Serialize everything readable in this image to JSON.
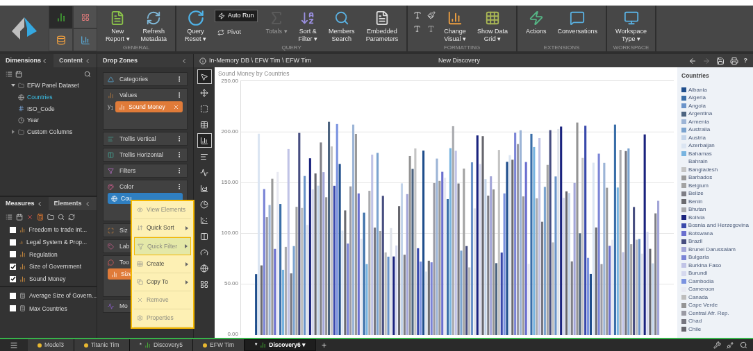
{
  "view_switcher": [
    {
      "selected": true
    },
    {
      "selected": false
    },
    {
      "selected": false
    },
    {
      "selected": false
    }
  ],
  "ribbon": [
    {
      "title": "GENERAL",
      "items": [
        {
          "kind": "large",
          "lines": [
            "New",
            "Report ▾"
          ],
          "disabled": false
        },
        {
          "kind": "large",
          "lines": [
            "Refresh",
            "Metadata"
          ],
          "disabled": false
        }
      ]
    },
    {
      "title": "QUERY",
      "items": [
        {
          "kind": "large",
          "lines": [
            "Query",
            "Reset ▾"
          ],
          "disabled": false
        },
        {
          "kind": "stack",
          "buttons": [
            {
              "label": "Auto Run",
              "on": true
            },
            {
              "label": "Pivot",
              "on": false
            }
          ]
        },
        {
          "kind": "large",
          "lines": [
            "Totals ▾"
          ],
          "disabled": true
        },
        {
          "kind": "large",
          "lines": [
            "Sort &",
            "Filter ▾"
          ],
          "disabled": false
        },
        {
          "kind": "large",
          "lines": [
            "Members",
            "Search"
          ],
          "disabled": false
        },
        {
          "kind": "large",
          "lines": [
            "Embedded",
            "Parameters"
          ],
          "disabled": false
        }
      ]
    },
    {
      "title": "FORMATTING",
      "items": [
        {
          "kind": "format"
        },
        {
          "kind": "large",
          "lines": [
            "Change",
            "Visual ▾"
          ],
          "disabled": false
        },
        {
          "kind": "large",
          "lines": [
            "Show Data",
            "Grid ▾"
          ],
          "disabled": false
        }
      ]
    },
    {
      "title": "EXTENSIONS",
      "items": [
        {
          "kind": "large",
          "lines": [
            "Actions"
          ],
          "disabled": false
        },
        {
          "kind": "large",
          "lines": [
            "Conversations"
          ],
          "disabled": false
        }
      ]
    },
    {
      "title": "WORKSPACE",
      "items": [
        {
          "kind": "large",
          "lines": [
            "Workspace",
            "Type ▾"
          ],
          "disabled": false
        }
      ]
    }
  ],
  "dimensions_panel": {
    "tabs": [
      {
        "label": "Dimensions",
        "selected": true
      },
      {
        "label": "Content",
        "selected": false
      }
    ],
    "tree": [
      {
        "label": "EFW Panel Dataset",
        "expanded": true,
        "children": [
          {
            "label": "Countries",
            "selected": true
          },
          {
            "label": "ISO_Code",
            "selected": false
          },
          {
            "label": "Year",
            "selected": false
          }
        ]
      },
      {
        "label": "Custom Columns",
        "expanded": false
      }
    ]
  },
  "measures_panel": {
    "tabs": [
      {
        "label": "Measures",
        "selected": true
      },
      {
        "label": "Elements",
        "selected": false
      }
    ],
    "measures": [
      {
        "label": "Freedom to trade int...",
        "checked": false
      },
      {
        "label": "Legal System & Prop...",
        "checked": false
      },
      {
        "label": "Regulation",
        "checked": false
      },
      {
        "label": "Size of Government",
        "checked": true
      },
      {
        "label": "Sound Money",
        "checked": true
      }
    ],
    "calculated": [
      {
        "label": "Average Size of Govern...",
        "checked": false
      },
      {
        "label": "Max Countries",
        "checked": false
      }
    ]
  },
  "drop_zones": {
    "title": "Drop Zones",
    "zones": [
      {
        "label": "Categories",
        "menu": true
      },
      {
        "label": "Values",
        "menu": true,
        "axis": "y$_{1}$",
        "chips": [
          {
            "label": "Sound Money",
            "kind": "measure",
            "removable": true
          }
        ]
      },
      {
        "label": "Trellis Vertical",
        "menu": true
      },
      {
        "label": "Trellis Horizontal",
        "menu": true
      },
      {
        "label": "Filters",
        "menu": true
      },
      {
        "label": "Color",
        "menu": true,
        "chips": [
          {
            "label": "Cou",
            "kind": "dimension"
          }
        ]
      },
      {
        "label": "Siz"
      },
      {
        "label": "Lab"
      },
      {
        "label": "Too",
        "chips": [
          {
            "label": "Size",
            "kind": "measure"
          }
        ]
      },
      {
        "label": "Mo"
      }
    ]
  },
  "context_menu": [
    {
      "label": "View Elements",
      "disabled": true,
      "submenu": false,
      "selected": false
    },
    {
      "label": "Quick Sort",
      "disabled": false,
      "submenu": true,
      "selected": false
    },
    {
      "label": "Quick Filter",
      "disabled": true,
      "submenu": true,
      "selected": true
    },
    {
      "label": "Create",
      "disabled": false,
      "submenu": true,
      "selected": false
    },
    {
      "label": "Copy To",
      "disabled": false,
      "submenu": true,
      "selected": false
    },
    {
      "label": "Remove",
      "disabled": true,
      "submenu": false,
      "selected": false
    },
    {
      "label": "Properties",
      "disabled": true,
      "submenu": false,
      "selected": false
    }
  ],
  "header": {
    "breadcrumb": "In-Memory DB \\ EFW Tim \\ EFW Tim",
    "title": "New Discovery",
    "help": "?"
  },
  "tools": [
    {
      "selected": true
    },
    {
      "selected": false
    },
    {
      "selected": false
    },
    {
      "selected": false
    },
    {
      "selected": true
    },
    {
      "selected": false
    },
    {
      "selected": false
    },
    {
      "selected": false
    },
    {
      "selected": false
    },
    {
      "selected": false
    },
    {
      "selected": false
    },
    {
      "selected": false
    },
    {
      "selected": false
    },
    {
      "selected": false
    }
  ],
  "chart": {
    "title": "Sound Money by Countries",
    "y_labels": [
      "250.00",
      "200.00",
      "150.00",
      "100.00",
      "50.00",
      "0.00"
    ]
  },
  "legend": {
    "title": "Countries",
    "items": [
      {
        "label": "Albania",
        "color": "#1f4e8c"
      },
      {
        "label": "Algeria",
        "color": "#3a6ea8"
      },
      {
        "label": "Angola",
        "color": "#6a93c9"
      },
      {
        "label": "Argentina",
        "color": "#4d6480"
      },
      {
        "label": "Armenia",
        "color": "#9cb4d6"
      },
      {
        "label": "Australia",
        "color": "#7ba3cf"
      },
      {
        "label": "Austria",
        "color": "#c3d4ea"
      },
      {
        "label": "Azerbaijan",
        "color": "#dbe5f2"
      },
      {
        "label": "Bahamas",
        "color": "#78b4e0"
      },
      {
        "label": "Bahrain"
      },
      {
        "label": "Bangladesh",
        "color": "#c4c4c4"
      },
      {
        "label": "Barbados",
        "color": "#999999"
      },
      {
        "label": "Belgium",
        "color": "#a3a3a3"
      },
      {
        "label": "Belize",
        "color": "#7f7f86"
      },
      {
        "label": "Benin",
        "color": "#6b6b70"
      },
      {
        "label": "Bhutan",
        "color": "#a9aaae"
      },
      {
        "label": "Bolivia",
        "color": "#1a237e"
      },
      {
        "label": "Bosnia and Herzegovina",
        "color": "#3949ab"
      },
      {
        "label": "Botswana",
        "color": "#6a6fcf"
      },
      {
        "label": "Brazil",
        "color": "#474e80"
      },
      {
        "label": "Brunei Darussalam",
        "color": "#a3a6d8"
      },
      {
        "label": "Bulgaria",
        "color": "#7a84d6"
      },
      {
        "label": "Burkina Faso",
        "color": "#c0c3e6"
      },
      {
        "label": "Burundi",
        "color": "#d5d8ee"
      },
      {
        "label": "Cambodia",
        "color": "#7b93e0"
      },
      {
        "label": "Cameroon",
        "color": "#e8e9f2"
      },
      {
        "label": "Canada",
        "color": "#bdbdbd"
      },
      {
        "label": "Cape Verde",
        "color": "#949494"
      },
      {
        "label": "Central Afr. Rep.",
        "color": "#9a9aa3"
      },
      {
        "label": "Chad",
        "color": "#76767f"
      },
      {
        "label": "Chile",
        "color": "#66666d"
      }
    ]
  },
  "tabs": [
    {
      "label": "Model3",
      "kind": "model",
      "selected": false
    },
    {
      "label": "Titanic Tim",
      "kind": "model",
      "selected": false
    },
    {
      "label": "Discovery5",
      "marker": "*",
      "kind": "discovery",
      "selected": false
    },
    {
      "label": "EFW Tim",
      "kind": "model",
      "selected": false
    },
    {
      "label": "Discovery6 ▾",
      "marker": "*",
      "kind": "discovery",
      "selected": true
    }
  ],
  "add_tab": "+"
}
